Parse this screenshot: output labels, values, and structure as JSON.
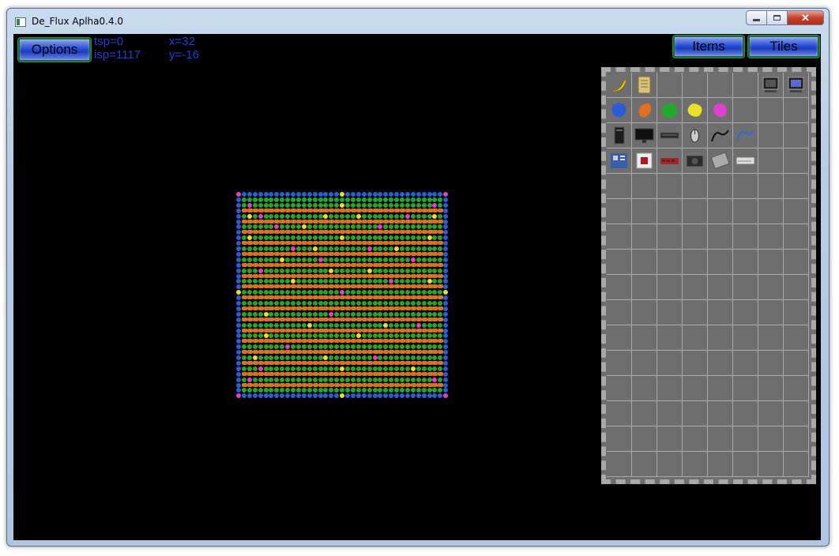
{
  "window": {
    "title": "De_Flux Aplha0.4.0"
  },
  "toolbar": {
    "options_label": "Options",
    "items_label": "Items",
    "tiles_label": "Tiles"
  },
  "stats": {
    "tsp": "tsp=0",
    "isp": "isp=1117",
    "x": "x=32",
    "y": "y=-16"
  },
  "colors": {
    "tile_blue": "#2a5ed8",
    "tile_green": "#1faa2a",
    "tile_orange": "#e0701e",
    "tile_yellow": "#e8e020",
    "tile_pink": "#e040d0",
    "panel_bg": "#6e6e6e",
    "button_blue": "#2a4fd6"
  },
  "map": {
    "rows": [
      "PBBBBBBBBBBBBBBBBBBYBBBBBBBBBBBBBBBBBBP",
      "BGGGGGGGGGGGGGGGGGGGGGGGGGGGGGGGGGGGGGB",
      "BGPGGGGGGGGGGGGGGGGYGGGGGGGGGGGGGGGGPGB",
      "BOOOOOOOOOOOOOOOOOOOOOOOOOOOOOOOOOOOOOB",
      "BGYGPGGGGGGGGGGGYGGGGGYGGGGGGGGPGGGGYGB",
      "BOOOOOOOOOOOOOOOOOOOOOOOOOOOOOOOOOOOOOB",
      "BGGGGGGPGGGGYGGGGGGGGGGGGGPGGGGGGGGGGGB",
      "BOOOOOOOOOOOOOOOOOOOOOOOOOOOOOOOOOOOOOB",
      "BGYGGGGGGGGGGGGGGGGYGGGGGGGGGGGGGGGYGGB",
      "BOOOOOOOOOOOOOOOOOOOOOOOOOOOOOOOOOOOOOB",
      "BGGGGGGGGGPGGGYGGGGGGGGGPGGGGYGGGGGGGGB",
      "BOOOOOOOOOOOOOOOOOOOOOOOOOOOOOOOOOOOOOB",
      "BGGGGGGGYGGGGGGPGGGGGGGGGGGGGGGGPGGGGGB",
      "BOOOOOOOOOOOOOOOOOOOOOOOOOOOOOOOOOOOOOB",
      "BGGGPGGGGGGGGGGGGYGGGGGGYGGGGGGGGGGGGGB",
      "BOOOOOOOOOOOOOOOOOOOOOOOOOOOOOOOOOOOOOB",
      "BGGGGGGGGGYGGGGGGGGGGGGGGGGGPGGGGGGYGGB",
      "BOOOOOOOOOOOOOOOOOOOOOOOOOOOOOOOOOOOOOB",
      "YGGGGGGGGGGGGGGGGGGPGGGGGGGGGGGGGGGGGGY",
      "BOOOOOOOOOOOOOOOOOOOOOOOOOOOOOOOOOOOOOB",
      "BGGGGGGGGGGGGGGGGGGGGGGGGGGGGGGGGGGGGGB",
      "BOOOOOOOOOOOOOOOOOOOOOOOOOOOOOOOOOOOOOB",
      "BGGGGYGGGGGGGGGGGPGGGGGGGGGGGGGGGGGGGGB",
      "BOOOOOOOOOOOOOOOOOOOOOOOOOOOOOOOOOOOOOB",
      "BGGGGGGGGGGGGYGGGGGGGGGGGGGYGGGGGPGGGGB",
      "BOOOOOOOOOOOOOOOOOOOOOOOOOOOOOOOOOOOOOB",
      "BGGGGYGGGGGGGGGGGGGGGGYGGGGGGGGGGGGGGGB",
      "BOOOOOOOOOOOOOOOOOOOOOOOOOOOOOOOOOOOOOB",
      "BGGGGGGGGPGGGGGGGGGGGGGGGGGGGGGGGGGGGGB",
      "BOOOOOOOOOOOOOOOOOOOOOOOOOOOOOOOOOOOOOB",
      "BGGYGGGGGGGGGGGGYGGGGGGGGPGGGGGGGGGGGGB",
      "BOOOOOOOOOOOOOOOOOOOOOOOOOOOOOOOOOOOOOB",
      "BGGGPGGGGGGGGGGGGGGYGGGGGGGGGGGGYGGGGGB",
      "BOOOOOOOOOOOOOOOOOOOOOOOOOOOOOOOOOOOOOB",
      "BGPGGGGGGGGGGGGGGGGGGGGGGGGGGGGGGGGGPGB",
      "BOOOOOOOOOOOOOOOOOOOOOOOOOOOOOOOOOOOOOB",
      "BGGGGGGGGGGGGGGGGGGGGGGGGGGGGGGGGGGGGGB",
      "PBBBBBBBBBBBBBBBBBBYBBBBBBBBBBBBBBBBBBP"
    ]
  },
  "inventory": {
    "columns": 8,
    "rows": 16,
    "items": [
      {
        "name": "banana-item",
        "icon": "banana"
      },
      {
        "name": "scroll-item",
        "icon": "scroll"
      },
      null,
      null,
      null,
      null,
      {
        "name": "computer-item",
        "icon": "computer"
      },
      {
        "name": "computer-display-item",
        "icon": "computer-display"
      },
      {
        "name": "blue-blob-item",
        "icon": "blob-blue"
      },
      {
        "name": "orange-blob-item",
        "icon": "blob-orange"
      },
      {
        "name": "green-blob-item",
        "icon": "blob-green"
      },
      {
        "name": "yellow-blob-item",
        "icon": "blob-yellow"
      },
      {
        "name": "pink-blob-item",
        "icon": "blob-pink"
      },
      null,
      null,
      null,
      {
        "name": "pc-tower-item",
        "icon": "pc-tower"
      },
      {
        "name": "monitor-item",
        "icon": "monitor"
      },
      {
        "name": "keyboard-item",
        "icon": "keyboard"
      },
      {
        "name": "mouse-item",
        "icon": "mouse"
      },
      {
        "name": "black-cable-item",
        "icon": "cable-black"
      },
      {
        "name": "blue-cable-item",
        "icon": "cable-blue"
      },
      null,
      null,
      {
        "name": "motherboard-item",
        "icon": "motherboard"
      },
      {
        "name": "cpu-item",
        "icon": "cpu"
      },
      {
        "name": "ram-item",
        "icon": "ram"
      },
      {
        "name": "power-supply-item",
        "icon": "power-supply"
      },
      {
        "name": "hard-drive-item",
        "icon": "hard-drive"
      },
      {
        "name": "optical-drive-item",
        "icon": "optical-drive"
      },
      null,
      null
    ]
  }
}
